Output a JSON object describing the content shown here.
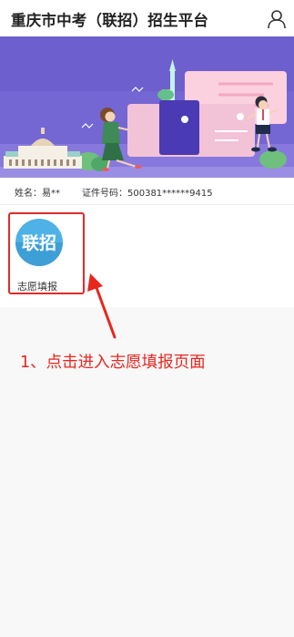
{
  "header": {
    "title": "重庆市中考（联招）招生平台"
  },
  "student": {
    "name_text": "姓名：易**",
    "id_text": "证件号码：500381******9415"
  },
  "apps": [
    {
      "icon_text": "联招",
      "label": "志愿填报"
    }
  ],
  "annotation": {
    "text": "1、点击进入志愿填报页面"
  },
  "colors": {
    "highlight": "#e02b2b",
    "annotation": "#e8261e",
    "banner_bg": "#7466d3",
    "app_icon": "#4fb2e6"
  }
}
